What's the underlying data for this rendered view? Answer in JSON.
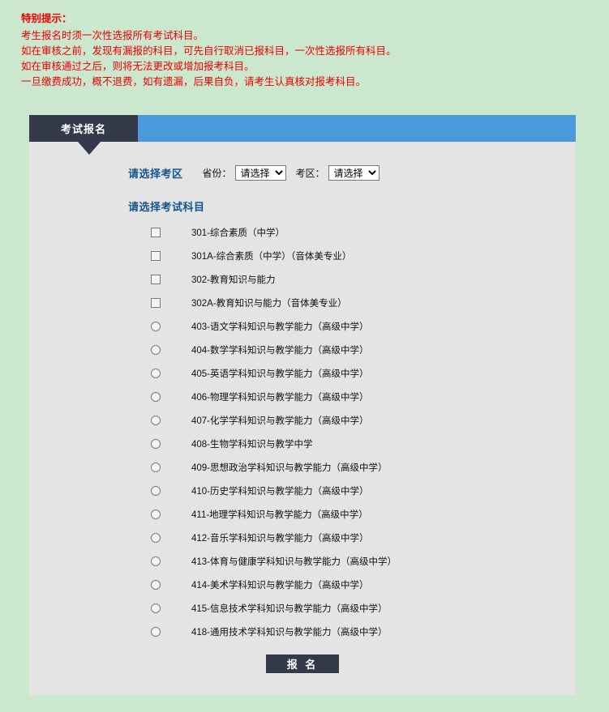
{
  "notice": {
    "title": "特别提示：",
    "lines": [
      "考生报名时须一次性选报所有考试科目。",
      "如在审核之前，发现有漏报的科目，可先自行取消已报科目，一次性选报所有科目。",
      "如在审核通过之后，则将无法更改或增加报考科目。",
      "一旦缴费成功，概不退费，如有遗漏，后果自负，请考生认真核对报考科目。"
    ],
    "color": "#ee0000"
  },
  "panel": {
    "tab_label": "考试报名",
    "tab_color": "#343a4a",
    "topbar_color": "#4a99da",
    "background": "#e4e4e4"
  },
  "region": {
    "section_label": "请选择考区",
    "province_label": "省份：",
    "province_value": "请选择",
    "district_label": "考区：",
    "district_value": "请选择",
    "options": [
      "请选择"
    ]
  },
  "subjects": {
    "heading": "请选择考试科目",
    "items": [
      {
        "type": "checkbox",
        "label": "301-综合素质（中学）"
      },
      {
        "type": "checkbox",
        "label": "301A-综合素质（中学）（音体美专业）"
      },
      {
        "type": "checkbox",
        "label": "302-教育知识与能力"
      },
      {
        "type": "checkbox",
        "label": "302A-教育知识与能力（音体美专业）"
      },
      {
        "type": "radio",
        "label": "403-语文学科知识与教学能力（高级中学）"
      },
      {
        "type": "radio",
        "label": "404-数学学科知识与教学能力（高级中学）"
      },
      {
        "type": "radio",
        "label": "405-英语学科知识与教学能力（高级中学）"
      },
      {
        "type": "radio",
        "label": "406-物理学科知识与教学能力（高级中学）"
      },
      {
        "type": "radio",
        "label": "407-化学学科知识与教学能力（高级中学）"
      },
      {
        "type": "radio",
        "label": "408-生物学科知识与教学中学"
      },
      {
        "type": "radio",
        "label": "409-思想政治学科知识与教学能力（高级中学）"
      },
      {
        "type": "radio",
        "label": "410-历史学科知识与教学能力（高级中学）"
      },
      {
        "type": "radio",
        "label": "411-地理学科知识与教学能力（高级中学）"
      },
      {
        "type": "radio",
        "label": "412-音乐学科知识与教学能力（高级中学）"
      },
      {
        "type": "radio",
        "label": "413-体育与健康学科知识与教学能力（高级中学）"
      },
      {
        "type": "radio",
        "label": "414-美术学科知识与教学能力（高级中学）"
      },
      {
        "type": "radio",
        "label": "415-信息技术学科知识与教学能力（高级中学）"
      },
      {
        "type": "radio",
        "label": "418-通用技术学科知识与教学能力（高级中学）"
      }
    ]
  },
  "submit": {
    "label": "报 名"
  }
}
